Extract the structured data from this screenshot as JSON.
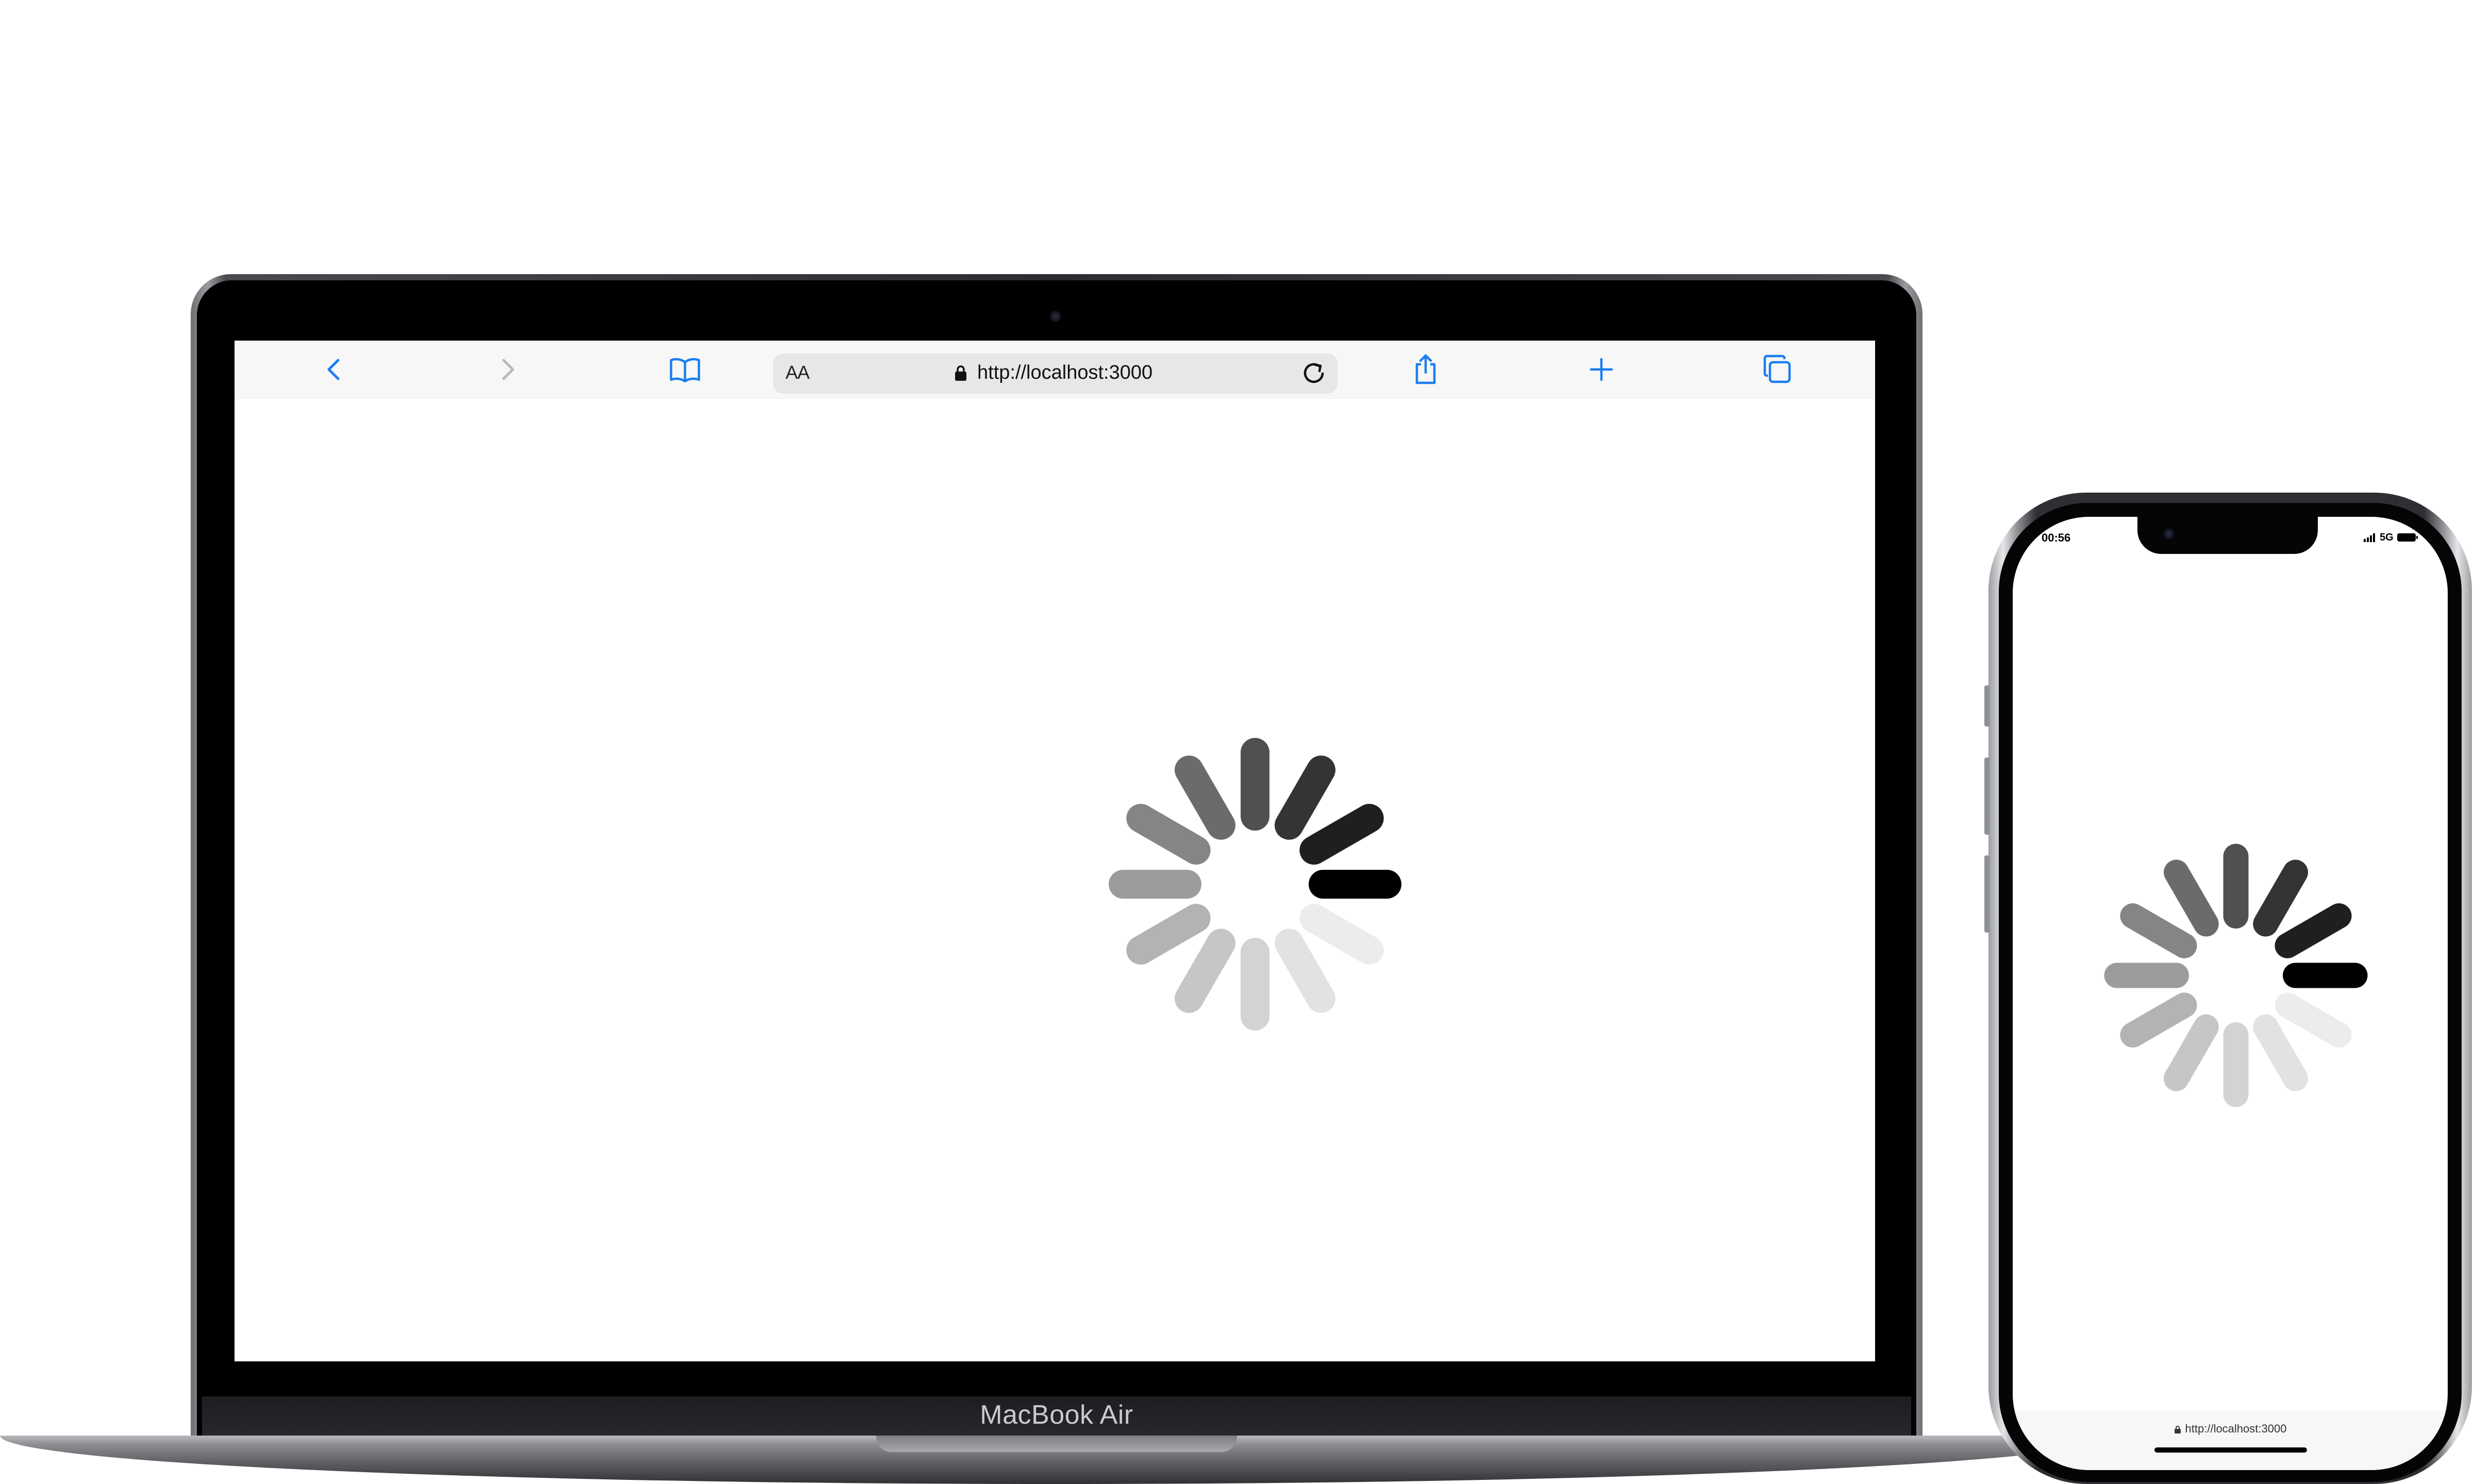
{
  "laptop": {
    "model_label": "MacBook Air",
    "browser": {
      "text_size_label": "AA",
      "url": "http://localhost:3000",
      "toolbar_icons": [
        "back-icon",
        "forward-icon",
        "bookmarks-icon",
        "lock-icon",
        "reload-icon",
        "share-icon",
        "new-tab-icon",
        "tabs-icon"
      ],
      "accent_color": "#1a7ef2"
    },
    "content": {
      "state": "loading",
      "spinner_icon": "loading-spinner-icon"
    }
  },
  "phone": {
    "status_bar": {
      "time": "00:56",
      "network": "5G",
      "icons": [
        "signal-icon",
        "battery-icon"
      ]
    },
    "content": {
      "state": "loading",
      "spinner_icon": "loading-spinner-icon"
    },
    "browser": {
      "url": "http://localhost:3000"
    }
  }
}
